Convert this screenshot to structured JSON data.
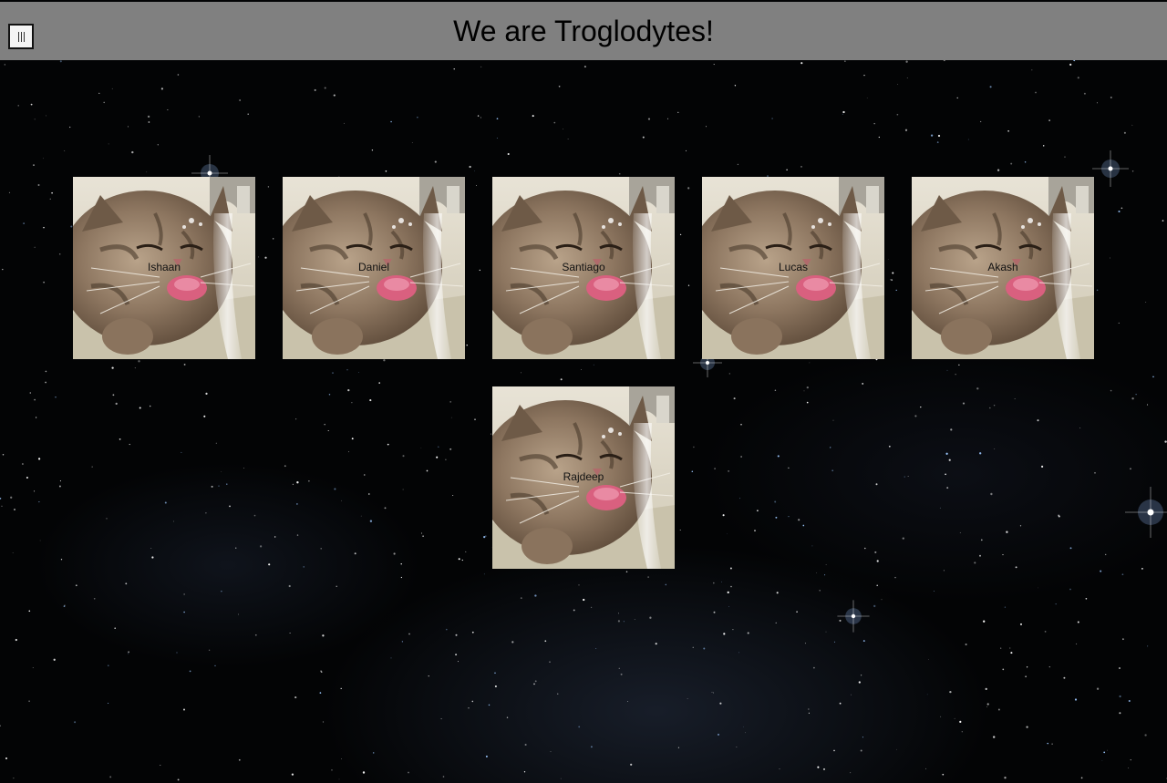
{
  "header": {
    "title": "We are Troglodytes!",
    "menu_icon": "hamburger-menu-icon"
  },
  "members": [
    {
      "name": "Ishaan"
    },
    {
      "name": "Daniel"
    },
    {
      "name": "Santiago"
    },
    {
      "name": "Lucas"
    },
    {
      "name": "Akash"
    },
    {
      "name": "Rajdeep"
    }
  ],
  "photo_subject": "cat-drinking-from-faucet-photo",
  "colors": {
    "header_bg": "#808080",
    "page_bg": "#030405"
  }
}
